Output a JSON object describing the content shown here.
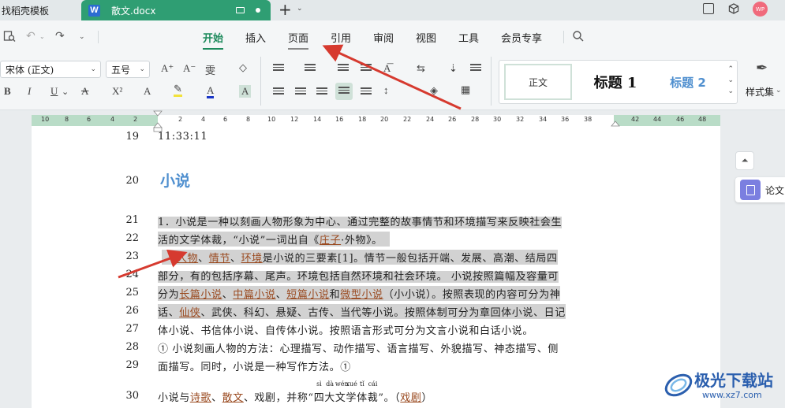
{
  "tabs": {
    "inactive_tab": "找稻壳模板",
    "active_doc": "散文.docx",
    "word_badge": "W"
  },
  "avatar_text": "WP",
  "menu": {
    "items": [
      "开始",
      "插入",
      "页面",
      "引用",
      "审阅",
      "视图",
      "工具",
      "会员专享"
    ],
    "active_index": 0,
    "highlighted_index": 2
  },
  "ribbon": {
    "font_name": "宋体 (正文)",
    "font_size": "五号",
    "styles": [
      "正文",
      "标题 1",
      "标题 2"
    ],
    "styles_label": "样式集",
    "buttons_row1": [
      "A⁺",
      "A⁻",
      "雯",
      "◇"
    ],
    "buttons_row2": [
      "B",
      "I",
      "U",
      "A",
      "X²",
      "A",
      "A"
    ]
  },
  "ruler": {
    "ticks": [
      "10",
      "8",
      "6",
      "4",
      "2",
      "2",
      "4",
      "6",
      "8",
      "10",
      "12",
      "14",
      "16",
      "18",
      "20",
      "22",
      "24",
      "26",
      "28",
      "30",
      "32",
      "34",
      "36",
      "38",
      "42",
      "44",
      "46",
      "48"
    ]
  },
  "document": {
    "line_numbers": [
      "19",
      "20",
      "21",
      "22",
      "23",
      "24",
      "25",
      "26",
      "27",
      "28",
      "29",
      "30"
    ],
    "line19": "11:33:11",
    "heading": "小说",
    "l21": "1．小说是一种以刻画人物形象为中心、通过完整的故事情节和环境描写来反映社会生",
    "l22a": "活的文学体裁，“小说”一词出自《",
    "l22_link": "庄子",
    "l22b": "·外物》。",
    "l23_links": [
      "人物",
      "情节",
      "环境"
    ],
    "l23_sep": "、",
    "l23_tail": "是小说的三要素[1]。情节一般包括开端、发展、高潮、结局四",
    "l24": "部分，有的包括序幕、尾声。环境包括自然环境和社会环境。 小说按照篇幅及容量可",
    "l25_pre": "分为",
    "l25_links": [
      "长篇小说",
      "中篇小说",
      "短篇小说",
      "微型小说"
    ],
    "l25_and": "和",
    "l25_tail": "（小小说）。按照表现的内容可分为神",
    "l26_pre": "话、",
    "l26_link": "仙侠",
    "l26_tail": "、武侠、科幻、悬疑、古传、当代等小说。按照体制可分为章回体小说、日记",
    "l27": "体小说、书信体小说、自传体小说。按照语言形式可分为文言小说和白话小说。",
    "l28": "① 小说刻画人物的方法：心理描写、动作描写、语言描写、外貌描写、神态描写、侧",
    "l29": "面描写。同时，小说是一种写作方法。①",
    "l30_pre": "小说与",
    "l30_links": [
      "诗歌",
      "散文"
    ],
    "l30_mid": "、戏剧，并称“",
    "l30_ruby": [
      {
        "char": "四",
        "py": "sì"
      },
      {
        "char": "大",
        "py": "dà"
      },
      {
        "char": "文",
        "py": "wén"
      },
      {
        "char": "学",
        "py": "xué"
      },
      {
        "char": "体",
        "py": "tǐ"
      },
      {
        "char": "裁",
        "py": "cái"
      }
    ],
    "l30_end": "”。（",
    "l30_link_end": "戏剧",
    "l30_close": "）"
  },
  "side": {
    "up_icon": "⏶",
    "lunwen_label": "论文"
  },
  "watermark": {
    "title": "极光下载站",
    "url": "www.xz7.com"
  },
  "colors": {
    "accent": "#1d8a5c",
    "tab_active": "#2f9e73",
    "heading": "#4f8fcf",
    "link": "#9a4a20",
    "highlight": "#d2d2d2",
    "arrow": "#d63a2f"
  }
}
